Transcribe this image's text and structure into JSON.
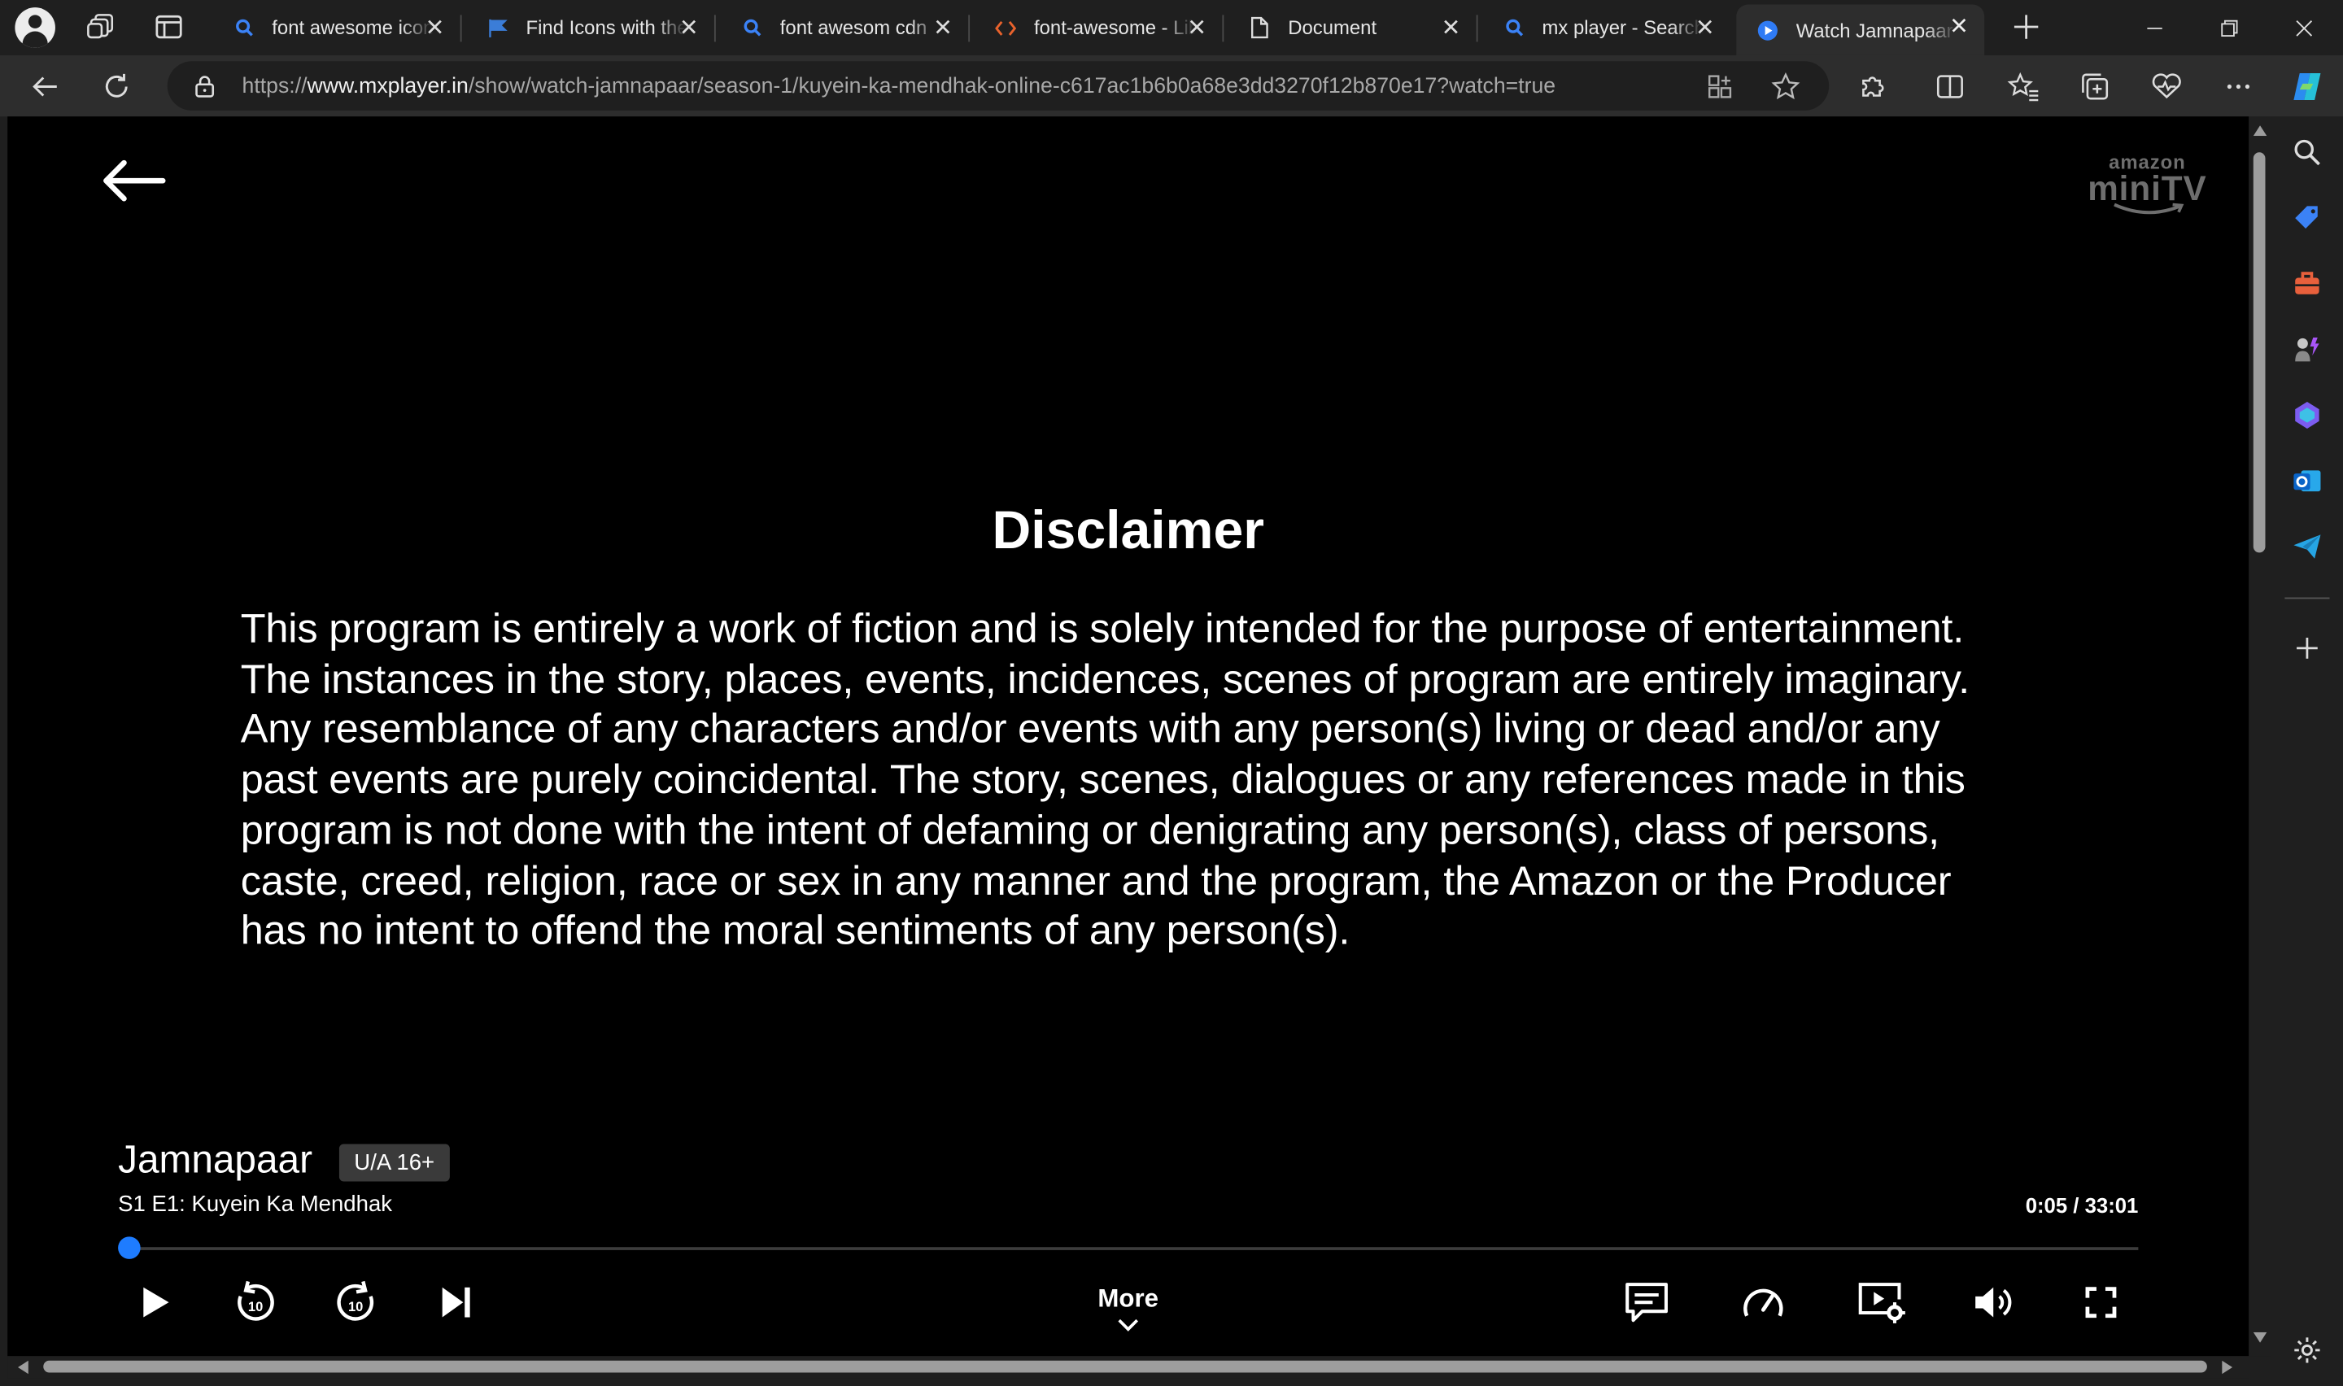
{
  "browser": {
    "tabs": [
      {
        "title": "font awesome icons",
        "favicon": "search-icon",
        "active": false
      },
      {
        "title": "Find Icons with the Perfect Look",
        "favicon": "flag-icon",
        "active": false
      },
      {
        "title": "font awesom cdn",
        "favicon": "search-icon",
        "active": false
      },
      {
        "title": "font-awesome - Libraries",
        "favicon": "code-icon",
        "active": false
      },
      {
        "title": "Document",
        "favicon": "document-icon",
        "active": false
      },
      {
        "title": "mx player - Search",
        "favicon": "search-icon",
        "active": false
      },
      {
        "title": "Watch Jamnapaar",
        "favicon": "play-circle-icon",
        "active": true
      }
    ],
    "url_prefix": "https://",
    "url_domain": "www.mxplayer.in",
    "url_path": "/show/watch-jamnapaar/season-1/kuyein-ka-mendhak-online-c617ac1b6b0a68e3dd3270f12b870e17?watch=true",
    "accent_color": "#1e7cff"
  },
  "player": {
    "brand_top": "amazon",
    "brand_bottom": "miniTV",
    "disclaimer_title": "Disclaimer",
    "disclaimer_text": "This program is entirely a work of fiction and is solely intended for the purpose of entertainment.\nThe instances in the story, places, events, incidences, scenes of program are entirely imaginary.\nAny resemblance of any characters and/or events with any person(s) living or dead and/or any\npast events are purely coincidental. The story, scenes, dialogues or any references made in this\nprogram is not done with the intent of defaming or denigrating any person(s), class of persons,\ncaste, creed, religion, race or sex in any manner and the program, the Amazon or the Producer\nhas no intent to offend the moral sentiments of any person(s).",
    "show_title": "Jamnapaar",
    "rating": "U/A 16+",
    "episode": "S1 E1: Kuyein Ka Mendhak",
    "time_display": "0:05 / 33:01",
    "progress_fraction": 0.0025,
    "more_label": "More",
    "skip_seconds": "10"
  }
}
